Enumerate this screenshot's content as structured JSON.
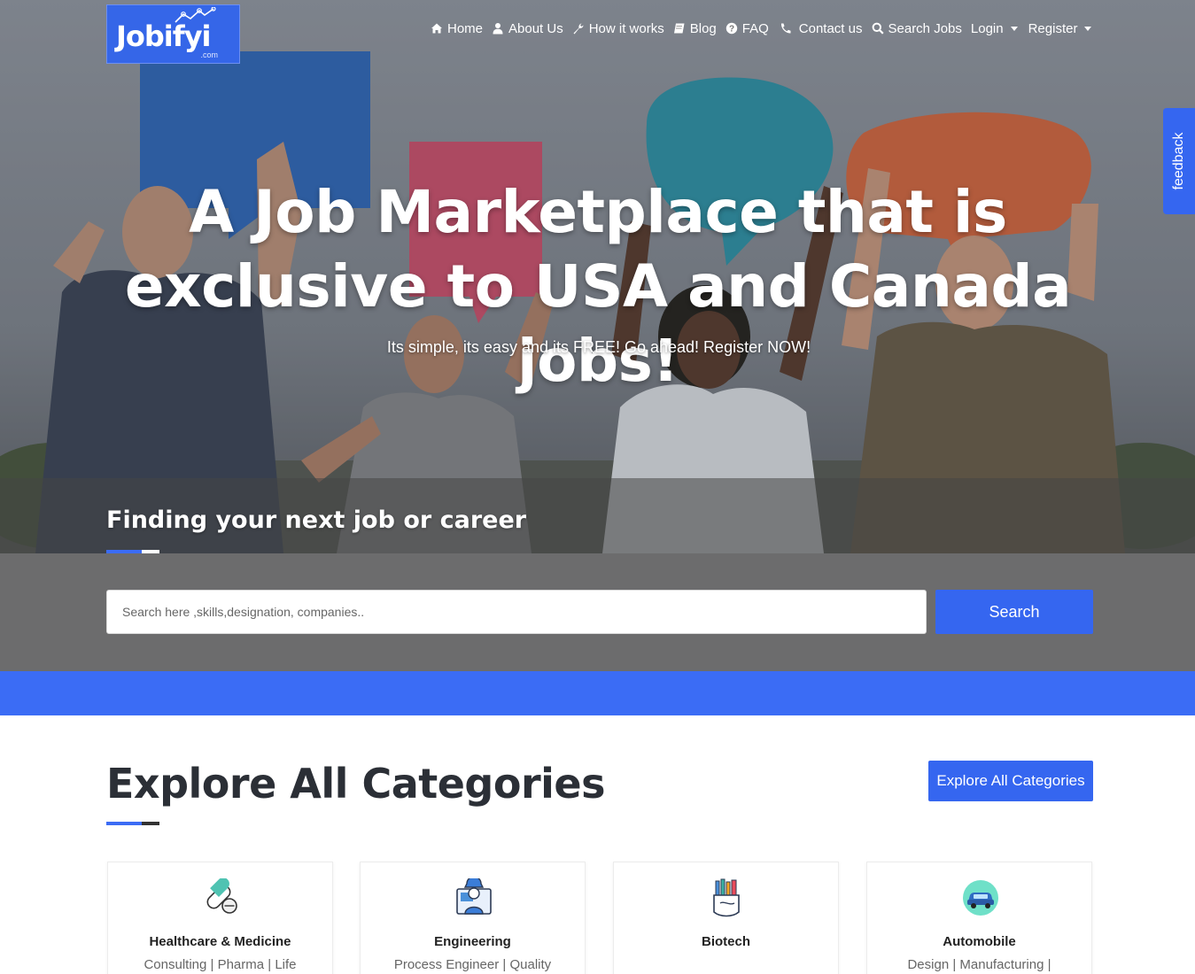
{
  "brand": {
    "logo_text": "Jobifyi",
    "logo_sub": ".com",
    "accent": "#3566f0"
  },
  "nav": {
    "items": [
      {
        "label": "Home",
        "icon": "home-icon"
      },
      {
        "label": "About Us",
        "icon": "user-icon"
      },
      {
        "label": "How it works",
        "icon": "wrench-icon"
      },
      {
        "label": "Blog",
        "icon": "book-icon"
      },
      {
        "label": "FAQ",
        "icon": "question-circle-icon"
      },
      {
        "label": "Contact us",
        "icon": "phone-icon"
      },
      {
        "label": "Search Jobs",
        "icon": "search-icon"
      }
    ],
    "login": "Login",
    "register": "Register"
  },
  "hero": {
    "title_line1": "A Job Marketplace that is",
    "title_line2": "exclusive to USA and Canada jobs!",
    "subtitle": "Its simple, its easy and its FREE! Go ahead! Register NOW!",
    "band_title": "Finding your next job or career"
  },
  "search": {
    "placeholder": "Search here ,skills,designation, companies..",
    "button": "Search"
  },
  "feedback": {
    "label": "feedback"
  },
  "categories": {
    "title": "Explore All Categories",
    "button": "Explore All Categories",
    "items": [
      {
        "name": "Healthcare & Medicine",
        "desc": "Consulting | Pharma | Life",
        "icon": "pill-icon"
      },
      {
        "name": "Engineering",
        "desc": "Process Engineer | Quality",
        "icon": "engineer-icon"
      },
      {
        "name": "Biotech",
        "desc": "",
        "icon": "lab-tools-icon"
      },
      {
        "name": "Automobile",
        "desc": "Design | Manufacturing |",
        "icon": "car-icon"
      }
    ]
  }
}
